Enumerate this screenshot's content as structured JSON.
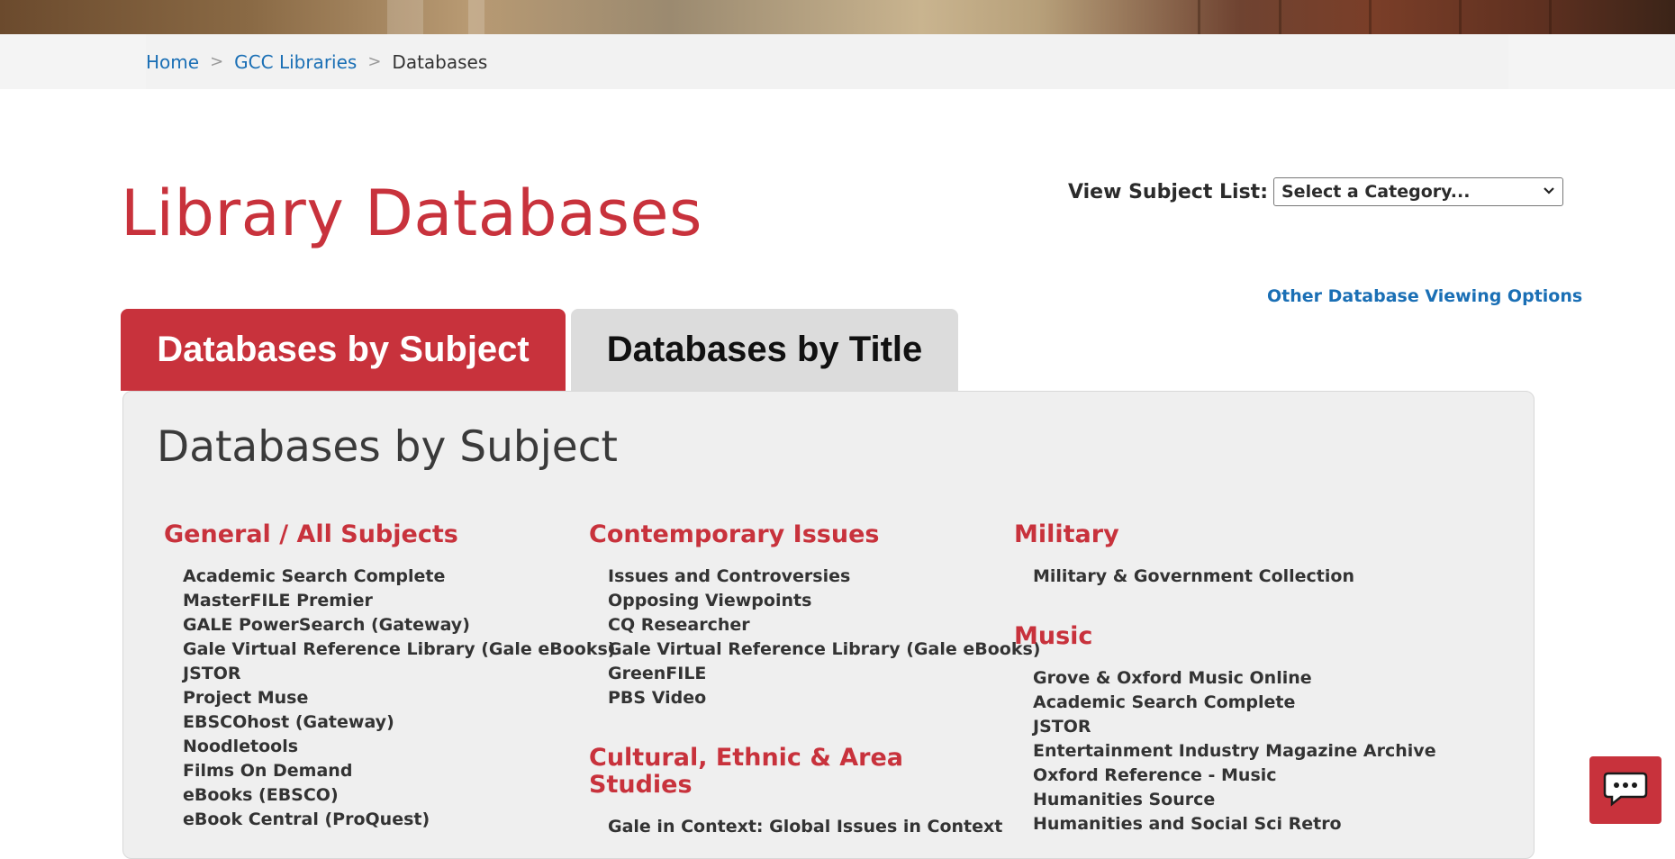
{
  "breadcrumb": {
    "home": "Home",
    "libraries": "GCC Libraries",
    "current": "Databases",
    "separator": ">"
  },
  "page_title": "Library Databases",
  "subject_select": {
    "label": "View Subject List:",
    "selected": "Select a Category..."
  },
  "other_options_link": "Other Database Viewing Options",
  "tabs": [
    {
      "label": "Databases by Subject",
      "active": true
    },
    {
      "label": "Databases by Title",
      "active": false
    }
  ],
  "panel_title": "Databases by Subject",
  "categories": {
    "general": {
      "heading": "General / All Subjects",
      "items": [
        "Academic Search Complete",
        "MasterFILE Premier",
        "GALE PowerSearch (Gateway)",
        "Gale Virtual Reference Library (Gale eBooks)",
        "JSTOR",
        "Project Muse",
        "EBSCOhost (Gateway)",
        "Noodletools",
        "Films On Demand",
        "eBooks (EBSCO)",
        "eBook Central (ProQuest)"
      ]
    },
    "contemporary": {
      "heading": "Contemporary Issues",
      "items": [
        "Issues and Controversies",
        "Opposing Viewpoints",
        "CQ Researcher",
        "Gale Virtual Reference Library (Gale eBooks)",
        "GreenFILE",
        "PBS Video"
      ]
    },
    "cultural": {
      "heading_line1": "Cultural, Ethnic & Area",
      "heading_line2": "Studies",
      "items": [
        "Gale in Context: Global Issues in Context"
      ]
    },
    "military": {
      "heading": "Military",
      "items": [
        "Military & Government Collection"
      ]
    },
    "music": {
      "heading": "Music",
      "items": [
        "Grove & Oxford Music Online",
        "Academic Search Complete",
        "JSTOR",
        "Entertainment Industry Magazine Archive",
        "Oxford Reference - Music",
        "Humanities Source",
        "Humanities and Social Sci Retro"
      ]
    }
  },
  "colors": {
    "brand_red": "#c8323c",
    "link_blue": "#1a6fb5",
    "panel_bg": "#efefef"
  },
  "icons": {
    "chat": "chat-bubble-icon",
    "dropdown": "chevron-down-icon"
  }
}
